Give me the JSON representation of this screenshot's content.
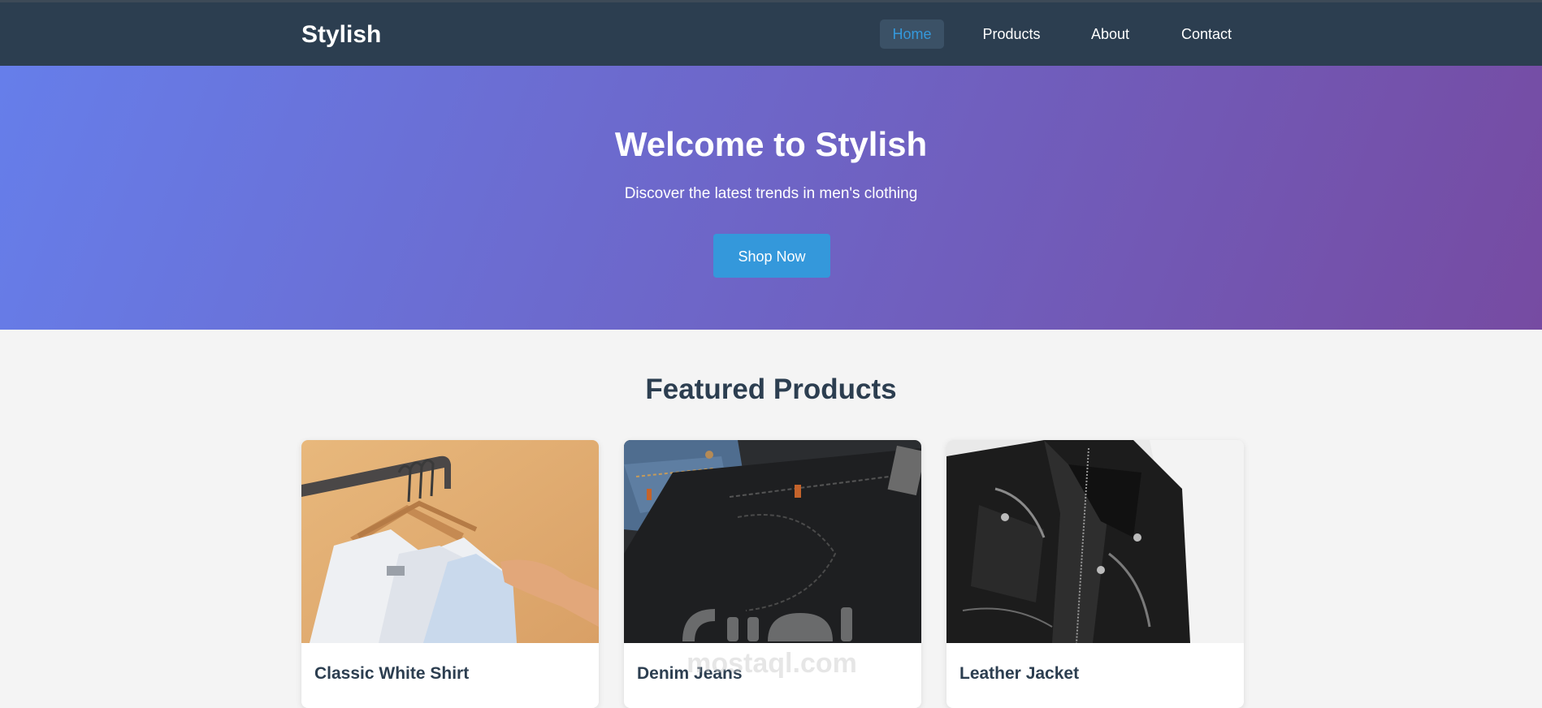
{
  "navbar": {
    "brand": "Stylish",
    "items": [
      {
        "label": "Home",
        "active": true
      },
      {
        "label": "Products",
        "active": false
      },
      {
        "label": "About",
        "active": false
      },
      {
        "label": "Contact",
        "active": false
      }
    ]
  },
  "hero": {
    "title": "Welcome to Stylish",
    "subtitle": "Discover the latest trends in men's clothing",
    "cta_label": "Shop Now"
  },
  "featured": {
    "title": "Featured Products",
    "products": [
      {
        "name": "Classic White Shirt",
        "image_icon": "white-shirt-photo"
      },
      {
        "name": "Denim Jeans",
        "image_icon": "denim-jeans-photo"
      },
      {
        "name": "Leather Jacket",
        "image_icon": "leather-jacket-photo"
      }
    ]
  },
  "watermark": {
    "text": "mostaql.com"
  },
  "colors": {
    "navbar": "#2c3e50",
    "accent": "#3498db",
    "hero_start": "#667eea",
    "hero_end": "#764ba2",
    "page_bg": "#f4f4f4"
  }
}
